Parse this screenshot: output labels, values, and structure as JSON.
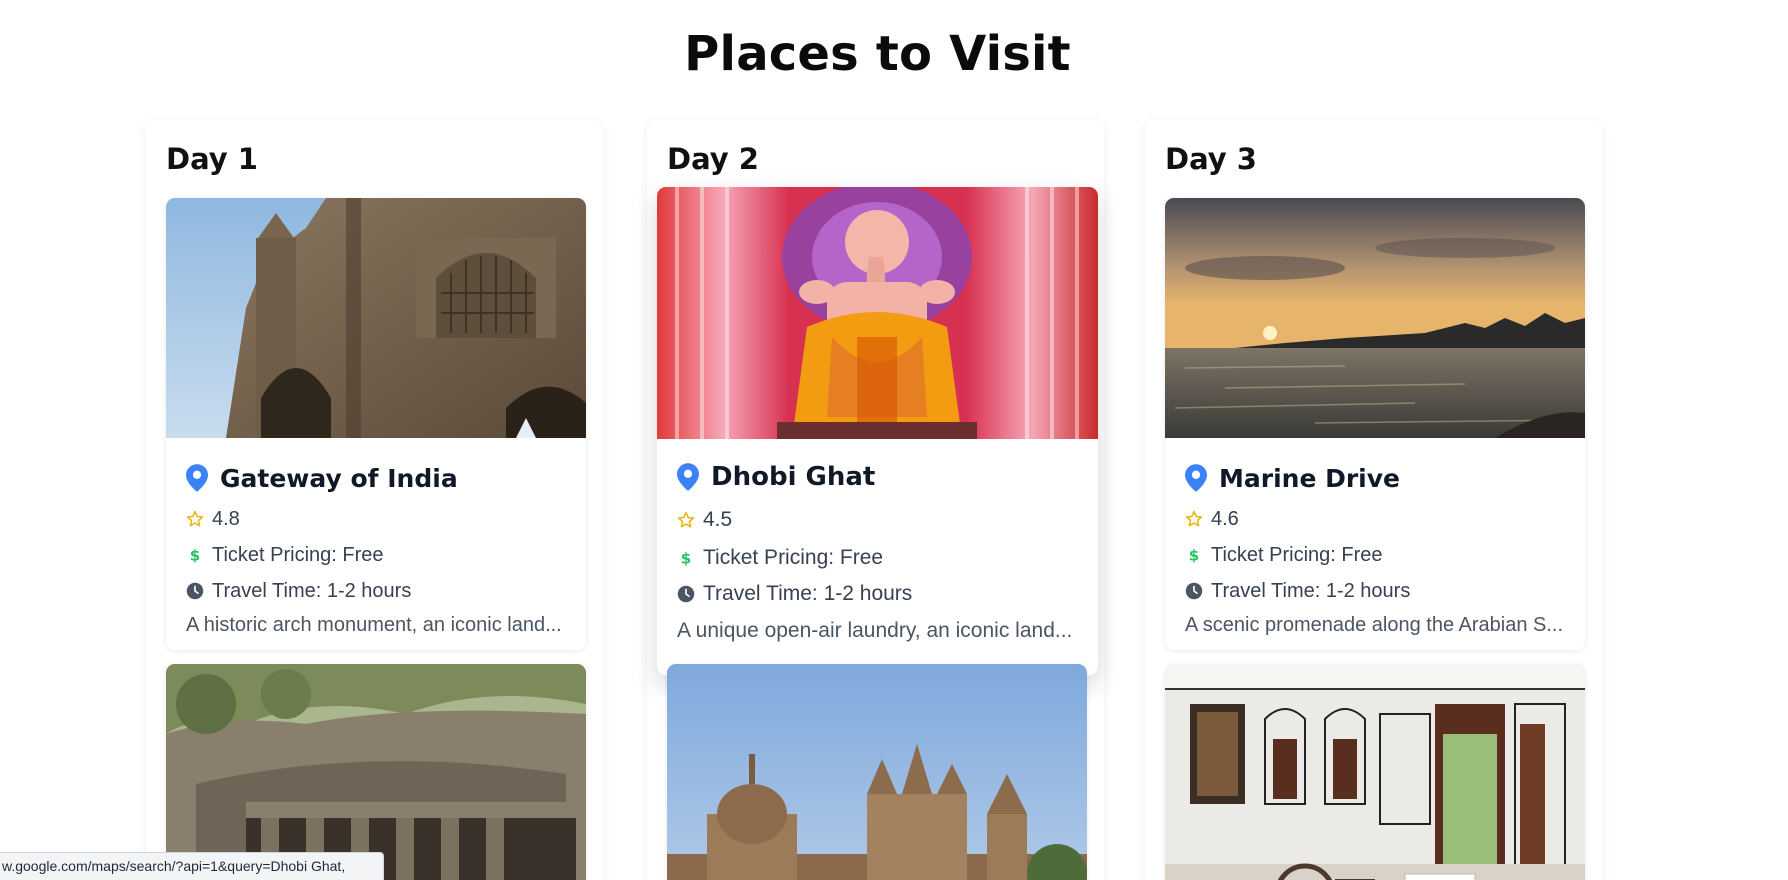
{
  "page": {
    "title": "Places to Visit"
  },
  "days": [
    {
      "label": "Day 1",
      "places": [
        {
          "name": "Gateway of India",
          "rating": "4.8",
          "ticket": "Ticket Pricing: Free",
          "travel": "Travel Time: 1-2 hours",
          "description": "A historic arch monument, an iconic land..."
        },
        {
          "name": "",
          "rating": "",
          "ticket": "",
          "travel": "",
          "description": ""
        }
      ]
    },
    {
      "label": "Day 2",
      "places": [
        {
          "name": "Dhobi Ghat",
          "rating": "4.5",
          "ticket": "Ticket Pricing: Free",
          "travel": "Travel Time: 1-2 hours",
          "description": "A unique open-air laundry, an iconic land..."
        },
        {
          "name": "",
          "rating": "",
          "ticket": "",
          "travel": "",
          "description": ""
        }
      ]
    },
    {
      "label": "Day 3",
      "places": [
        {
          "name": "Marine Drive",
          "rating": "4.6",
          "ticket": "Ticket Pricing: Free",
          "travel": "Travel Time: 1-2 hours",
          "description": "A scenic promenade along the Arabian S..."
        },
        {
          "name": "",
          "rating": "",
          "ticket": "",
          "travel": "",
          "description": ""
        }
      ]
    }
  ],
  "status_bar": {
    "url": "w.google.com/maps/search/?api=1&query=Dhobi Ghat,"
  },
  "colors": {
    "pin": "#3b82f6",
    "star": "#eab308",
    "dollar": "#22c55e",
    "clock": "#4b5563"
  },
  "icons": {
    "pin": "map-pin-icon",
    "star": "star-icon",
    "dollar": "dollar-icon",
    "clock": "clock-icon"
  }
}
